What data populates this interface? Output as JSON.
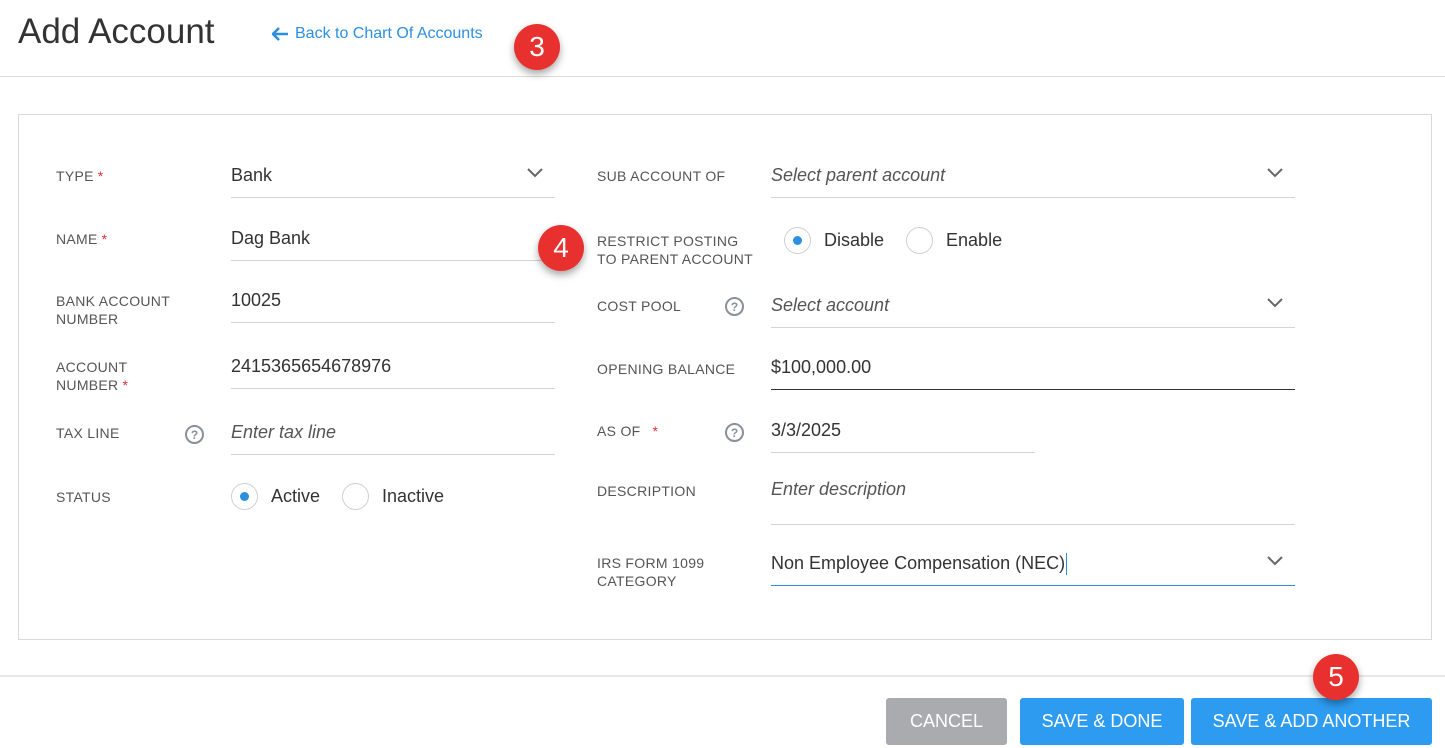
{
  "header": {
    "title": "Add Account",
    "back_link": "Back to Chart Of Accounts"
  },
  "badges": [
    "3",
    "4",
    "5"
  ],
  "left": {
    "type": {
      "label": "TYPE",
      "value": "Bank",
      "required": "*"
    },
    "name": {
      "label": "NAME",
      "value": "Dag Bank",
      "required": "*"
    },
    "bank_account_number": {
      "label_line1": "BANK ACCOUNT",
      "label_line2": "NUMBER",
      "value": "10025"
    },
    "account_number": {
      "label_line1": "ACCOUNT",
      "label_line2": "NUMBER",
      "value": "2415365654678976",
      "required": "*"
    },
    "tax_line": {
      "label": "TAX LINE",
      "placeholder": "Enter tax line"
    },
    "status": {
      "label": "STATUS",
      "options": [
        "Active",
        "Inactive"
      ],
      "selected": "Active"
    }
  },
  "right": {
    "sub_account_of": {
      "label": "SUB ACCOUNT OF",
      "placeholder": "Select parent account"
    },
    "restrict_posting": {
      "label_line1": "RESTRICT POSTING",
      "label_line2": "TO PARENT ACCOUNT",
      "options": [
        "Disable",
        "Enable"
      ],
      "selected": "Disable"
    },
    "cost_pool": {
      "label": "COST POOL",
      "placeholder": "Select account"
    },
    "opening_balance": {
      "label": "OPENING BALANCE",
      "value": "$100,000.00"
    },
    "as_of": {
      "label": "AS OF",
      "value": "3/3/2025",
      "required": "*"
    },
    "description": {
      "label": "DESCRIPTION",
      "placeholder": "Enter description"
    },
    "irs_form": {
      "label_line1": "IRS FORM 1099",
      "label_line2": "CATEGORY",
      "value": "Non Employee Compensation (NEC)"
    }
  },
  "footer": {
    "cancel": "CANCEL",
    "save_done": "SAVE & DONE",
    "save_add_another": "SAVE & ADD ANOTHER"
  },
  "colors": {
    "accent": "#2d8fe0",
    "button_primary": "#2d9cf0",
    "button_cancel": "#a9abae",
    "badge": "#e8312f",
    "required": "#e03030"
  },
  "icons": {
    "back": "arrow-left-icon",
    "dropdown": "chevron-down-icon",
    "help": "question-circle-icon"
  }
}
